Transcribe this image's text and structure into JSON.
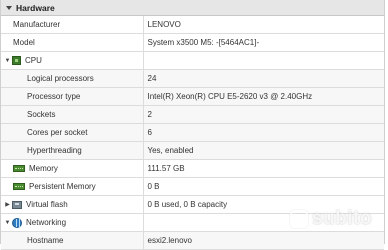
{
  "section": {
    "title": "Hardware"
  },
  "rows": {
    "manufacturer": {
      "label": "Manufacturer",
      "value": "LENOVO"
    },
    "model": {
      "label": "Model",
      "value": "System x3500 M5: -[5464AC1]-"
    },
    "cpu": {
      "label": "CPU",
      "icon": "cpu-icon"
    },
    "logical_processors": {
      "label": "Logical processors",
      "value": "24"
    },
    "processor_type": {
      "label": "Processor type",
      "value": "Intel(R) Xeon(R) CPU E5-2620 v3 @ 2.40GHz"
    },
    "sockets": {
      "label": "Sockets",
      "value": "2"
    },
    "cores_per_socket": {
      "label": "Cores per socket",
      "value": "6"
    },
    "hyperthreading": {
      "label": "Hyperthreading",
      "value": "Yes, enabled"
    },
    "memory": {
      "label": "Memory",
      "value": "111.57 GB",
      "icon": "memory-icon"
    },
    "persistent_memory": {
      "label": "Persistent Memory",
      "value": "0 B",
      "icon": "memory-icon"
    },
    "virtual_flash": {
      "label": "Virtual flash",
      "value": "0 B used, 0 B capacity",
      "icon": "flash-icon"
    },
    "networking": {
      "label": "Networking",
      "icon": "network-icon"
    },
    "hostname": {
      "label": "Hostname",
      "value": "esxi2.lenovo"
    }
  },
  "watermark": {
    "text": "subito"
  }
}
